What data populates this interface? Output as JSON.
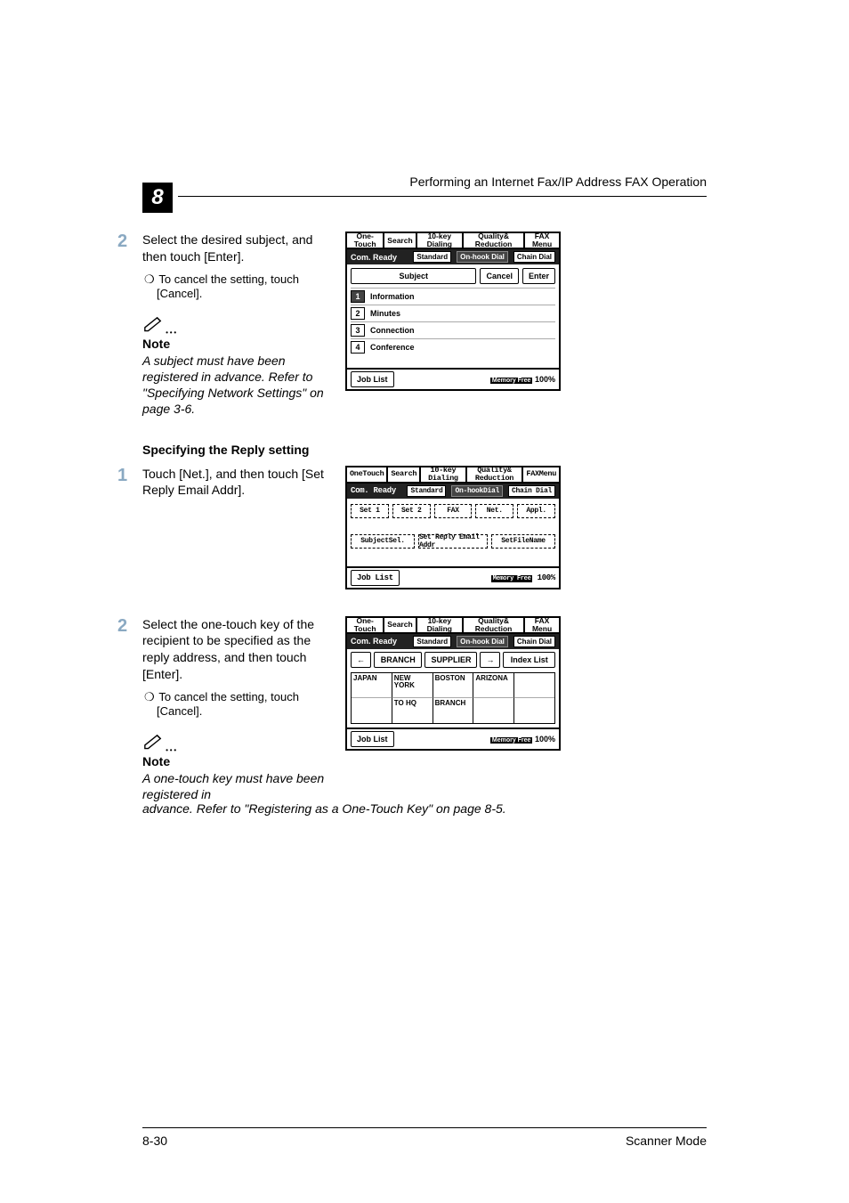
{
  "header": {
    "chapter": "8",
    "title": "Performing an Internet Fax/IP Address FAX Operation"
  },
  "section1": {
    "step2": {
      "num": "2",
      "text": "Select the desired subject, and then touch [Enter].",
      "sub1": "To cancel the setting, touch [Cancel]."
    },
    "note": {
      "heading": "Note",
      "body": "A subject must have been registered in advance. Refer to \"Specifying Network Settings\" on page 3-6."
    }
  },
  "section2": {
    "heading": "Specifying the Reply setting",
    "step1": {
      "num": "1",
      "text": "Touch [Net.], and then touch [Set Reply Email Addr]."
    }
  },
  "section3": {
    "step2": {
      "num": "2",
      "text": "Select the one-touch key of the recipient to be specified as the reply address, and then touch [Enter].",
      "sub1": "To cancel the setting, touch [Cancel]."
    },
    "note": {
      "heading": "Note",
      "body_top": "A one-touch key must have been registered in",
      "body_bottom": "advance. Refer to \"Registering as a One-Touch Key\" on page 8-5."
    }
  },
  "panel_subject": {
    "tabs": [
      "One-Touch",
      "Search",
      "10-key Dialing",
      "Quality& Reduction",
      "FAX Menu"
    ],
    "status_label": "Com. Ready",
    "status_btns": [
      "Standard",
      "On-hook Dial",
      "Chain Dial"
    ],
    "subject_label": "Subject",
    "cancel": "Cancel",
    "enter": "Enter",
    "items": [
      {
        "n": "1",
        "label": "Information",
        "selected": true
      },
      {
        "n": "2",
        "label": "Minutes",
        "selected": false
      },
      {
        "n": "3",
        "label": "Connection",
        "selected": false
      },
      {
        "n": "4",
        "label": "Conference",
        "selected": false
      }
    ],
    "joblist": "Job List",
    "memory": "Memory Free",
    "pct": "100%"
  },
  "panel_net": {
    "tabs": [
      "OneTouch",
      "Search",
      "10-key Dialing",
      "Quality& Reduction",
      "FAXMenu"
    ],
    "status_label": "Com. Ready",
    "status_btns": [
      "Standard",
      "On-hookDial",
      "Chain Dial"
    ],
    "sets": [
      "Set 1",
      "Set 2",
      "FAX",
      "Net.",
      "Appl."
    ],
    "actions": [
      "SubjectSel.",
      "Set Reply Email Addr",
      "SetFileName"
    ],
    "joblist": "Job List",
    "memory": "Memory Free",
    "pct": "100%"
  },
  "panel_onetouch": {
    "tabs": [
      "One-Touch",
      "Search",
      "10-key Dialing",
      "Quality& Reduction",
      "FAX Menu"
    ],
    "status_label": "Com. Ready",
    "status_btns": [
      "Standard",
      "On-hook Dial",
      "Chain Dial"
    ],
    "nav": {
      "left": "←",
      "branch": "BRANCH",
      "supplier": "SUPPLIER",
      "right": "→",
      "index": "Index List"
    },
    "grid": [
      [
        "JAPAN",
        "NEW YORK",
        "BOSTON",
        "ARIZONA",
        ""
      ],
      [
        "",
        "TO HQ",
        "BRANCH",
        "",
        ""
      ]
    ],
    "joblist": "Job List",
    "memory": "Memory Free",
    "pct": "100%"
  },
  "footer": {
    "page": "8-30",
    "mode": "Scanner Mode"
  }
}
